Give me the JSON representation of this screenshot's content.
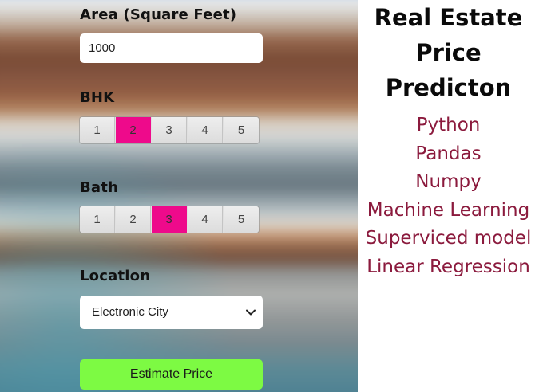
{
  "form": {
    "area": {
      "label": "Area (Square Feet)",
      "value": "1000"
    },
    "bhk": {
      "label": "BHK",
      "options": [
        "1",
        "2",
        "3",
        "4",
        "5"
      ],
      "selected": "2"
    },
    "bath": {
      "label": "Bath",
      "options": [
        "1",
        "2",
        "3",
        "4",
        "5"
      ],
      "selected": "3"
    },
    "location": {
      "label": "Location",
      "selected": "Electronic City"
    },
    "submit_label": "Estimate Price"
  },
  "info": {
    "title_lines": [
      "Real Estate",
      "Price",
      "Predicton"
    ],
    "tech": [
      "Python",
      "Pandas",
      "Numpy",
      "Machine Learning",
      "Superviced model",
      "Linear Regression"
    ]
  },
  "colors": {
    "selected_segment": "#ee0a8b",
    "submit_button": "#7dfa43",
    "tech_text": "#8b1a3d"
  },
  "icons": {
    "select_chevron": "chevron-down-icon"
  }
}
